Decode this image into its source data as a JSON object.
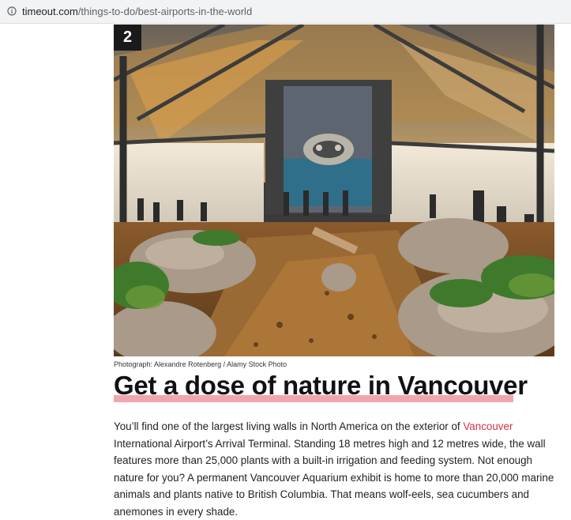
{
  "browser": {
    "url_host": "timeout.com",
    "url_path": "/things-to-do/best-airports-in-the-world",
    "info_icon": "info-icon"
  },
  "article": {
    "rank": "2",
    "photo_credit": "Photograph: Alexandre Rotenberg / Alamy Stock Photo",
    "headline": "Get a dose of nature in Vancouver",
    "body_part1": "You’ll find one of the largest living walls in North America on the exterior of ",
    "body_link": "Vancouver",
    "body_part2": " International Airport’s Arrival Terminal. Standing 18 metres high and 12 metres wide, the wall features more than 25,000 plants with a built-in irrigation and feeding system. Not enough nature for you? A permanent Vancouver Aquarium exhibit is home to more than 20,000 marine animals and plants native to British Columbia. That means wolf-eels, sea cucumbers and anemones in every shade.",
    "link_color": "#d6314a",
    "underline_color": "#f0a7ab"
  }
}
